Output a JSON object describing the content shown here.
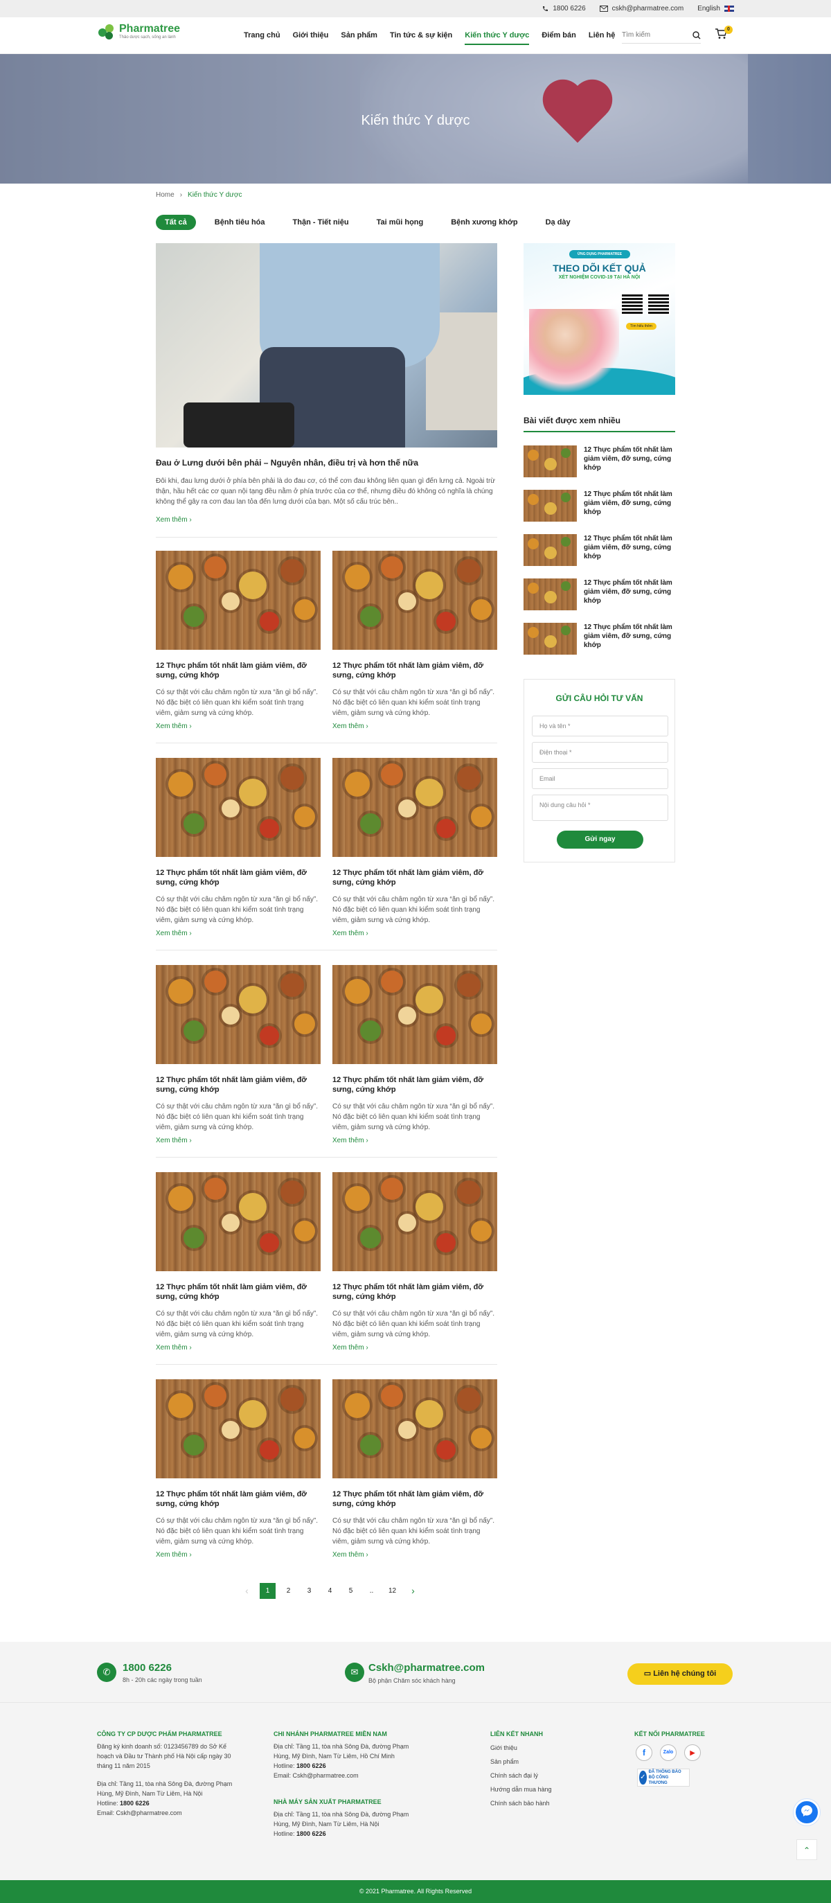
{
  "topbar": {
    "phone": "1800 6226",
    "email": "cskh@pharmatree.com",
    "language": "English"
  },
  "logo": {
    "name": "Pharmatree",
    "tagline": "Thảo dược sạch, sống an lành"
  },
  "nav": [
    "Trang chủ",
    "Giới thiệu",
    "Sản phẩm",
    "Tin tức & sự kiện",
    "Kiến thức Y dược",
    "Điểm bán",
    "Liên hệ"
  ],
  "search": {
    "placeholder": "Tìm kiếm"
  },
  "cart": {
    "count": "0"
  },
  "hero": {
    "title": "Kiến thức Y dược"
  },
  "breadcrumb": {
    "home": "Home",
    "current": "Kiến thức Y dược"
  },
  "tabs": [
    "Tất cả",
    "Bệnh tiêu hóa",
    "Thận - Tiết niệu",
    "Tai mũi họng",
    "Bệnh xương khớp",
    "Dạ dày"
  ],
  "featured": {
    "title": "Đau ở Lưng dưới bên phải – Nguyên nhân, điều trị và hơn thế nữa",
    "desc": "Đôi khi, đau lưng dưới ở phía bên phải là do đau cơ, có thể cơn đau không liên quan gì đến lưng cả. Ngoài trừ thận, hầu hết các cơ quan nội tạng đều nằm ở phía trước của cơ thể, nhưng điều đó không có nghĩa là chúng không thể gây ra cơn đau lan tỏa đến lưng dưới của bạn. Một số cấu trúc bên..",
    "more": "Xem thêm"
  },
  "articles": {
    "title": "12 Thực phẩm tốt nhất làm giảm viêm, đỡ sưng, cứng khớp",
    "desc": "Có sự thật với câu châm ngôn từ xưa “ăn gì bổ nấy”. Nó đặc biệt có liên quan khi kiểm soát tình trạng viêm, giảm sưng và cứng khớp.",
    "more": "Xem thêm"
  },
  "pagination": {
    "prev": "‹",
    "pages": [
      "1",
      "2",
      "3",
      "4",
      "5",
      "..",
      "12"
    ],
    "next": "›"
  },
  "ad": {
    "chip": "ỨNG DỤNG PHARMATREE",
    "headline": "THEO DÕI KẾT QUẢ",
    "sub": "XÉT NGHIỆM COVID-19 TẠI HÀ NỘI",
    "button": "Tìm hiểu thêm"
  },
  "sidebar": {
    "popular_title": "Bài viết được xem nhiều",
    "popular_item": "12 Thực phẩm tốt nhất làm giảm viêm, đỡ sưng, cứng khớp"
  },
  "form": {
    "title": "GỬI CÂU HỎI TƯ VẤN",
    "name": "Họ và tên *",
    "phone": "Điện thoại *",
    "email": "Email",
    "question": "Nội dung câu hỏi *",
    "submit": "Gửi ngay"
  },
  "contact": {
    "phone": "1800 6226",
    "phone_note": "8h - 20h các ngày trong tuần",
    "email": "Cskh@pharmatree.com",
    "email_note": "Bộ phận Chăm sóc khách hàng",
    "button": "Liên hệ chúng tôi"
  },
  "footer": {
    "col1_title": "CÔNG TY CP DƯỢC PHẨM PHARMATREE",
    "col1_reg": "Đăng ký kinh doanh số: 0123456789 do Sở Kế hoạch và Đầu tư Thành phố Hà Nội cấp ngày 30 tháng 11 năm 2015",
    "col1_addr": "Địa chỉ: Tầng 11, tòa nhà Sông Đà, đường Phạm Hùng, Mỹ Đình, Nam Từ Liêm, Hà Nội",
    "hotline_label": "Hotline:",
    "hotline": "1800 6226",
    "col1_email": "Email: Cskh@pharmatree.com",
    "col2_title": "CHI NHÁNH PHARMATREE MIỀN NAM",
    "col2_addr": "Địa chỉ: Tầng 11, tòa nhà Sông Đà, đường Phạm Hùng, Mỹ Đình, Nam Từ Liêm, Hồ Chí Minh",
    "col2_email": "Email: Cskh@pharmatree.com",
    "col3_title": "NHÀ MÁY SẢN XUẤT PHARMATREE",
    "col3_addr": "Địa chỉ: Tầng 11, tòa nhà Sông Đà, đường Phạm Hùng, Mỹ Đình, Nam Từ Liêm, Hà Nội",
    "links_title": "LIÊN KẾT NHANH",
    "links": [
      "Giới thiệu",
      "Sản phẩm",
      "Chính sách đại lý",
      "Hướng dẫn mua hàng",
      "Chính sách bảo hành"
    ],
    "social_title": "KẾT NỐI PHARMATREE",
    "social": [
      "f",
      "Zalo",
      "▶"
    ],
    "bct_text": "ĐÃ THÔNG BÁO BỘ CÔNG THƯƠNG"
  },
  "copyright": "© 2021 Pharmatree. All Rights Reserved",
  "colors": {
    "brand": "#1f8a3c",
    "accent": "#f5cf1c"
  }
}
